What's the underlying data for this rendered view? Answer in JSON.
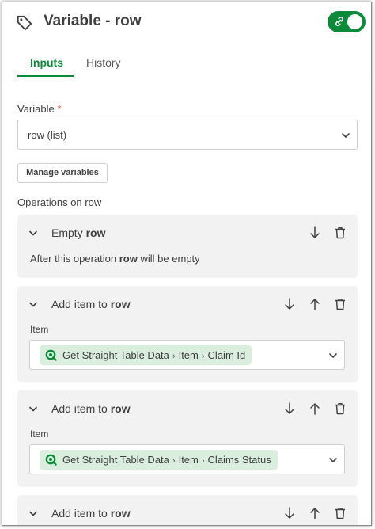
{
  "header": {
    "title": "Variable - row",
    "toggle_on": true
  },
  "tabs": [
    {
      "label": "Inputs",
      "active": true
    },
    {
      "label": "History",
      "active": false
    }
  ],
  "variable_field": {
    "label": "Variable",
    "required_mark": "*",
    "value": "row (list)"
  },
  "manage_button": "Manage variables",
  "operations_label": "Operations on row",
  "operations": [
    {
      "title_prefix": "Empty",
      "title_var": "row",
      "desc_prefix": "After this operation",
      "desc_var": "row",
      "desc_suffix": "will be empty"
    },
    {
      "title_prefix": "Add item to",
      "title_var": "row",
      "item_label": "Item",
      "chip": [
        "Get Straight Table Data",
        "Item",
        "Claim Id"
      ]
    },
    {
      "title_prefix": "Add item to",
      "title_var": "row",
      "item_label": "Item",
      "chip": [
        "Get Straight Table Data",
        "Item",
        "Claims Status"
      ]
    },
    {
      "title_prefix": "Add item to",
      "title_var": "row"
    }
  ],
  "colors": {
    "accent": "#0b8a3a",
    "chip_bg": "#daeedd",
    "card_bg": "#f2f2f2",
    "required": "#dc423e"
  },
  "icons": {
    "chip_source": "qlik-q-icon",
    "chip_separator": "›"
  }
}
